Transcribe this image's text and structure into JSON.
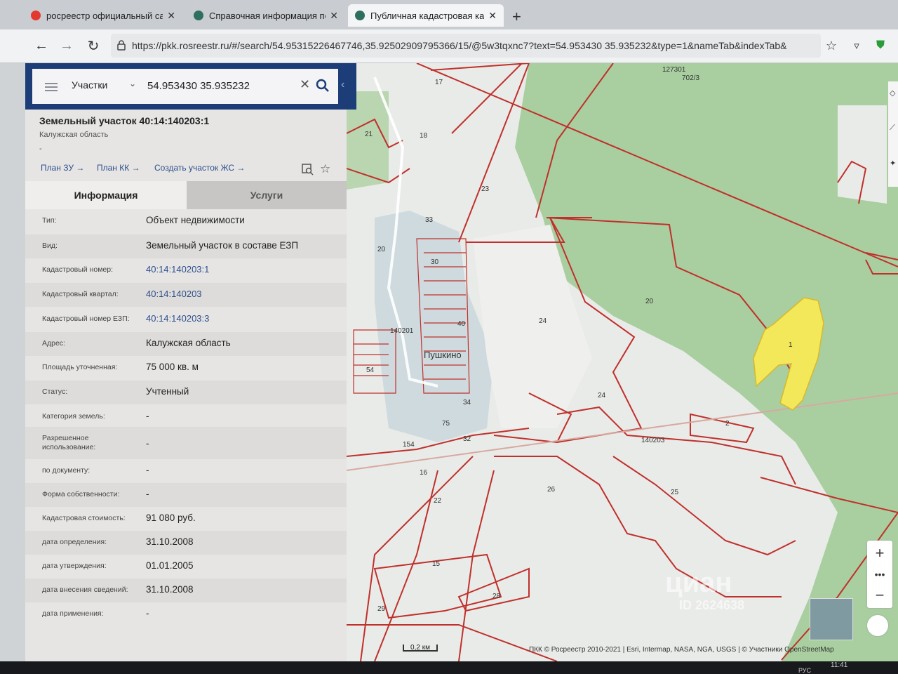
{
  "browser": {
    "tabs": [
      {
        "label": "росреестр официальный сайт",
        "active": false
      },
      {
        "label": "Справочная информация по о",
        "active": false
      },
      {
        "label": "Публичная кадастровая карта",
        "active": true
      }
    ],
    "url": "https://pkk.rosreestr.ru/#/search/54.95315226467746,35.92502909795366/15/@5w3tqxnc7?text=54.953430 35.935232&type=1&nameTab&indexTab&"
  },
  "search": {
    "layer": "Участки",
    "query": "54.953430 35.935232"
  },
  "parcel": {
    "title": "Земельный участок 40:14:140203:1",
    "region": "Калужская область",
    "dash": "-",
    "links": [
      "План ЗУ",
      "План КК",
      "Создать участок ЖС"
    ],
    "tabs": {
      "info": "Информация",
      "services": "Услуги"
    }
  },
  "attributes": [
    {
      "key": "Тип:",
      "value": "Объект недвижимости",
      "link": false
    },
    {
      "key": "Вид:",
      "value": "Земельный участок в составе ЕЗП",
      "link": false
    },
    {
      "key": "Кадастровый номер:",
      "value": "40:14:140203:1",
      "link": true
    },
    {
      "key": "Кадастровый квартал:",
      "value": "40:14:140203",
      "link": true
    },
    {
      "key": "Кадастровый номер ЕЗП:",
      "value": "40:14:140203:3",
      "link": true
    },
    {
      "key": "Адрес:",
      "value": "Калужская область",
      "link": false
    },
    {
      "key": "Площадь уточненная:",
      "value": "75 000 кв. м",
      "link": false
    },
    {
      "key": "Статус:",
      "value": "Учтенный",
      "link": false
    },
    {
      "key": "Категория земель:",
      "value": "-",
      "link": false
    },
    {
      "key": "Разрешенное использование:",
      "value": "-",
      "link": false
    },
    {
      "key": "по документу:",
      "value": "-",
      "link": false
    },
    {
      "key": "Форма собственности:",
      "value": "-",
      "link": false
    },
    {
      "key": "Кадастровая стоимость:",
      "value": "91 080 руб.",
      "link": false
    },
    {
      "key": "дата определения:",
      "value": "31.10.2008",
      "link": false
    },
    {
      "key": "дата утверждения:",
      "value": "01.01.2005",
      "link": false
    },
    {
      "key": "дата внесения сведений:",
      "value": "31.10.2008",
      "link": false
    },
    {
      "key": "дата применения:",
      "value": "-",
      "link": false
    }
  ],
  "map": {
    "labels": [
      "127301",
      "702/3",
      "17",
      "21",
      "18",
      "23",
      "33",
      "20",
      "30",
      "40",
      "140201",
      "Пушкино",
      "54",
      "34",
      "75",
      "32",
      "154",
      "16",
      "22",
      "15",
      "29",
      "28",
      "26",
      "25",
      "24",
      "24",
      "20",
      "1",
      "2",
      "140203"
    ],
    "scale": "0,2 км",
    "attribution": "ПКК © Росреестр 2010-2021 | Esri, Intermap, NASA, NGA, USGS | © Участники OpenStreetMap",
    "watermark": "циан",
    "watermark_id": "ID 2624638"
  },
  "taskbar": {
    "lang": "РУС",
    "time": "11:41"
  },
  "colors": {
    "boundary": "#c0302c",
    "selected_parcel": "#f2e85a",
    "forest": "#a9cfa0",
    "header": "#1c3d78",
    "link": "#2d4f8c"
  }
}
